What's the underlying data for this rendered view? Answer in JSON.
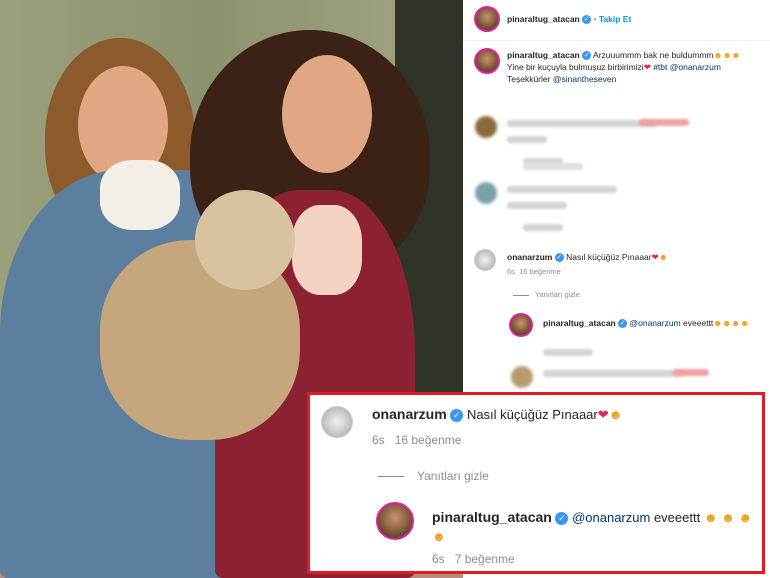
{
  "post": {
    "header": {
      "username": "pinaraltug_atacan",
      "follow_label": "Takip Et",
      "separator": "•"
    },
    "caption": {
      "username": "pinaraltug_atacan",
      "line1": "Arzuuummm bak ne buldummm",
      "line2_a": "Yine bir kuçuyla bulmuşuz birbirimizi",
      "line2_b": "#tbt",
      "line2_c": "@onanarzum",
      "line3_a": "Teşekkürler",
      "line3_b": "@sinantheseven"
    },
    "comment": {
      "username": "onanarzum",
      "text": "Nasıl küçüğüz Pınaaar",
      "time": "6s",
      "likes": "16 beğenme",
      "hide_replies": "Yanıtları gizle"
    },
    "reply": {
      "username": "pinaraltug_atacan",
      "mention": "@onanarzum",
      "text": "eveeettt"
    }
  },
  "zoom": {
    "comment": {
      "username": "onanarzum",
      "text": "Nasıl küçüğüz Pınaaar",
      "time": "6s",
      "likes": "16 beğenme",
      "hide_replies": "Yanıtları gizle"
    },
    "reply": {
      "username": "pinaraltug_atacan",
      "mention": "@onanarzum",
      "text": "eveeettt",
      "time": "6s",
      "likes": "7 beğenme"
    }
  },
  "colors": {
    "accent": "#0095f6",
    "highlight_border": "#e21b23",
    "heart": "#e0245e"
  },
  "icons": [
    "verified-badge-icon",
    "heart-emoji-icon",
    "smiling-heart-emoji-icon"
  ]
}
